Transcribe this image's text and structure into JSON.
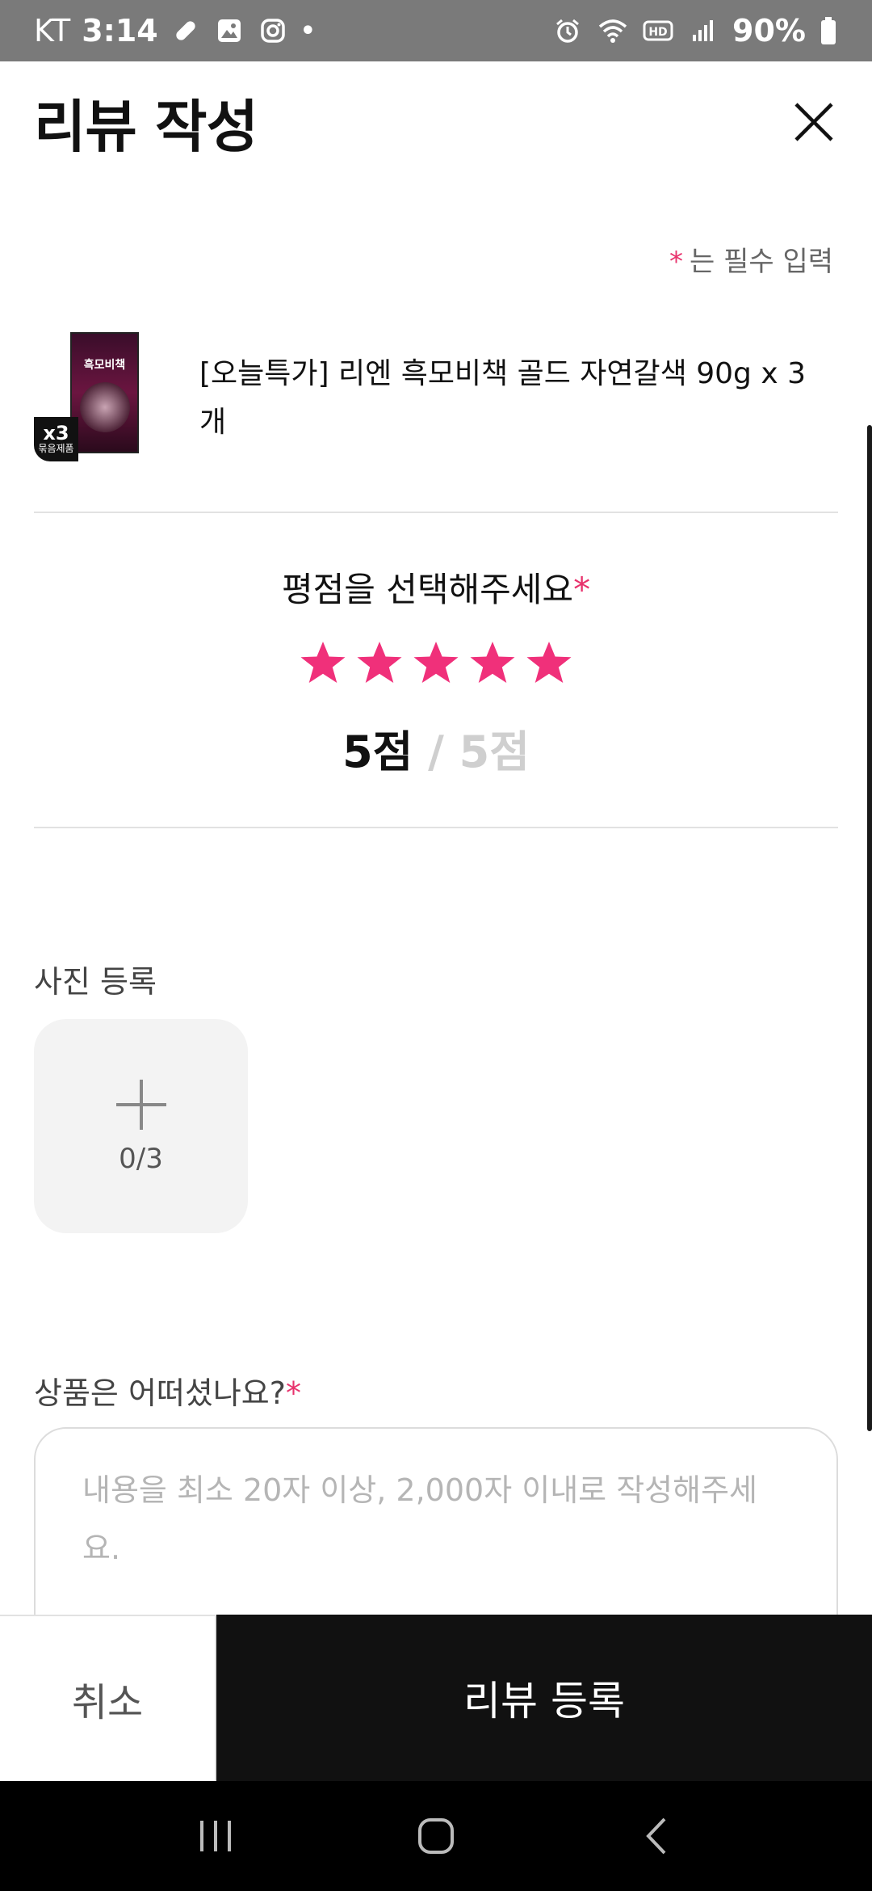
{
  "status_bar": {
    "carrier": "KT",
    "time": "3:14",
    "battery": "90%",
    "icons_left": [
      "bandage-icon",
      "image-icon",
      "instagram-icon",
      "dot"
    ],
    "icons_right": [
      "alarm-icon",
      "wifi-icon",
      "hd-icon",
      "signal-icon",
      "battery-icon"
    ]
  },
  "header": {
    "title": "리뷰 작성"
  },
  "form": {
    "required_note_star": "*",
    "required_note": "는 필수 입력",
    "product": {
      "name": "[오늘특가] 리엔 흑모비책 골드 자연갈색 90g x 3개",
      "thumb_brand": "흑모비책",
      "badge_qty": "x3",
      "badge_sub": "묶음제품"
    },
    "rating": {
      "title": "평점을 선택해주세요",
      "required_mark": "*",
      "value": 5,
      "max": 5,
      "score_text": "5점",
      "max_text": " / 5점",
      "star_color": "#f0307a"
    },
    "photo": {
      "label": "사진 등록",
      "count": "0/3"
    },
    "review": {
      "label": "상품은 어떠셨나요?",
      "required_mark": "*",
      "placeholder": "내용을 최소 20자 이상, 2,000자 이내로 작성해주세요.",
      "value": ""
    }
  },
  "actions": {
    "cancel_label": "취소",
    "submit_label": "리뷰 등록"
  },
  "colors": {
    "accent": "#e8336d",
    "submit_bg": "#111111"
  }
}
